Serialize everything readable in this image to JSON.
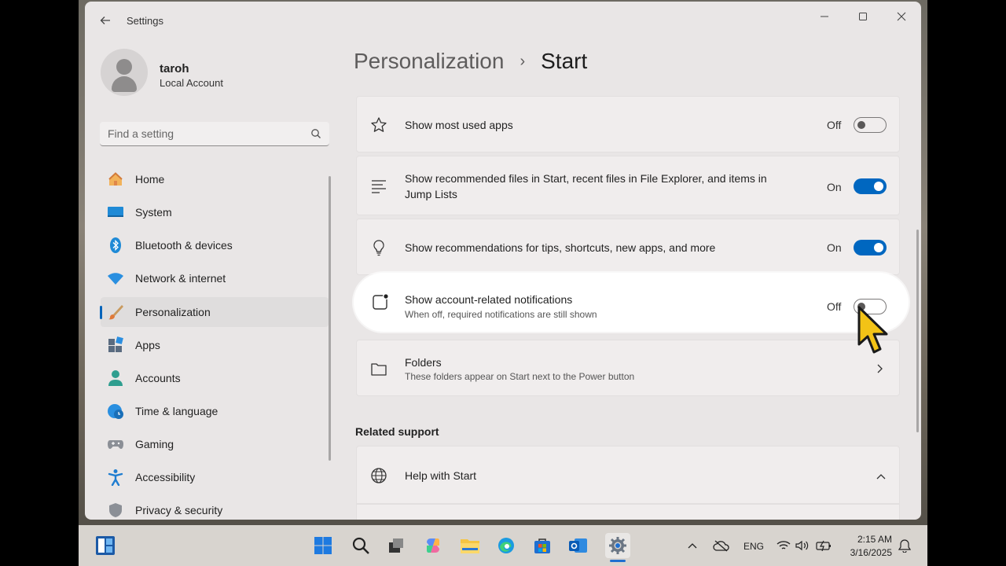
{
  "window": {
    "title": "Settings"
  },
  "profile": {
    "name": "taroh",
    "account_type": "Local Account"
  },
  "search": {
    "placeholder": "Find a setting"
  },
  "sidebar": {
    "items": [
      {
        "label": "Home",
        "icon": "home-icon"
      },
      {
        "label": "System",
        "icon": "system-icon"
      },
      {
        "label": "Bluetooth & devices",
        "icon": "bluetooth-icon"
      },
      {
        "label": "Network & internet",
        "icon": "wifi-icon"
      },
      {
        "label": "Personalization",
        "icon": "paintbrush-icon",
        "active": true
      },
      {
        "label": "Apps",
        "icon": "apps-icon"
      },
      {
        "label": "Accounts",
        "icon": "person-icon"
      },
      {
        "label": "Time & language",
        "icon": "clock-globe-icon"
      },
      {
        "label": "Gaming",
        "icon": "gamepad-icon"
      },
      {
        "label": "Accessibility",
        "icon": "accessibility-icon"
      },
      {
        "label": "Privacy & security",
        "icon": "shield-icon"
      }
    ]
  },
  "breadcrumb": {
    "parent": "Personalization",
    "separator": "›",
    "current": "Start"
  },
  "settings": [
    {
      "title": "Show most used apps",
      "state": "Off",
      "icon": "star-icon"
    },
    {
      "title": "Show recommended files in Start, recent files in File Explorer, and items in",
      "title2": "Jump Lists",
      "state": "On",
      "icon": "list-icon"
    },
    {
      "title": "Show recommendations for tips, shortcuts, new apps, and more",
      "state": "On",
      "icon": "lightbulb-icon"
    },
    {
      "title": "Show account-related notifications",
      "subtitle": "When off, required notifications are still shown",
      "state": "Off",
      "icon": "notification-badge-icon"
    },
    {
      "title": "Folders",
      "subtitle": "These folders appear on Start next to the Power button",
      "icon": "folder-icon"
    }
  ],
  "related": {
    "heading": "Related support",
    "items": [
      {
        "title": "Help with Start",
        "icon": "globe-icon"
      }
    ]
  },
  "taskbar": {
    "language": "ENG",
    "time": "2:15 AM",
    "date": "3/16/2025"
  },
  "colors": {
    "accent": "#0067c0"
  }
}
